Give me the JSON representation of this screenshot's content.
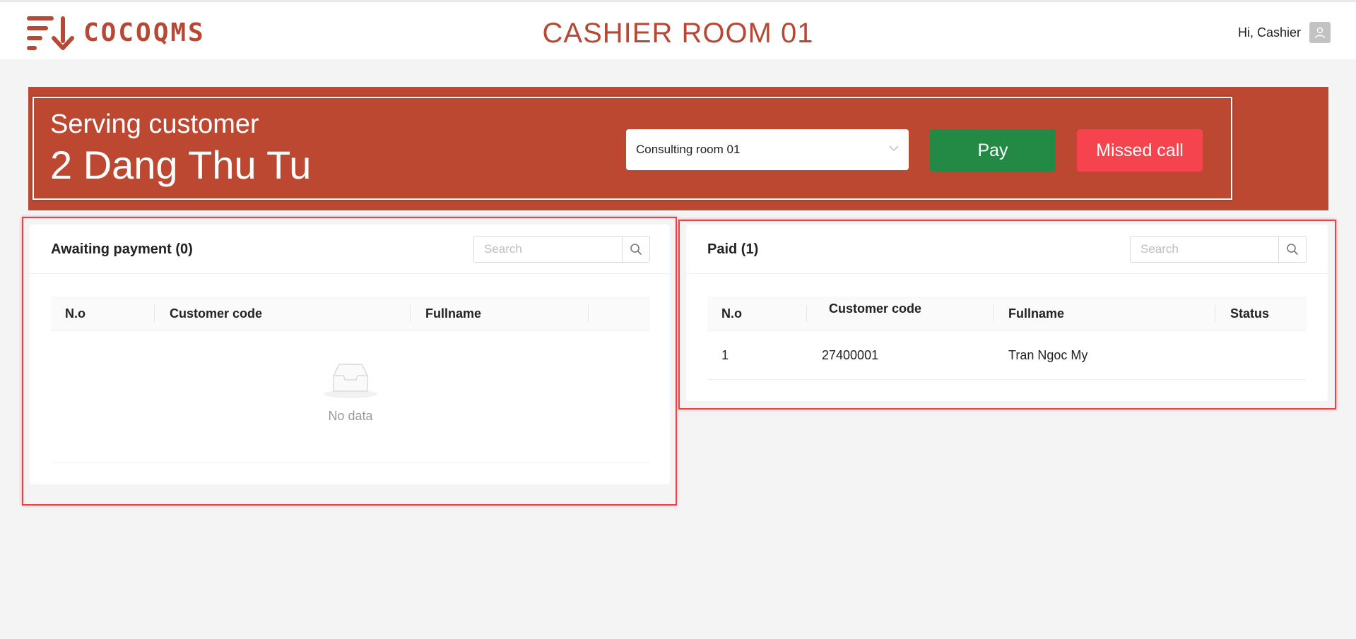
{
  "header": {
    "logo_text": "COCOQMS",
    "title": "CASHIER ROOM 01",
    "greeting": "Hi, Cashier"
  },
  "banner": {
    "serving_label": "Serving customer",
    "customer": "2 Dang Thu Tu",
    "room_select": {
      "value": "Consulting room 01"
    },
    "pay_label": "Pay",
    "missed_label": "Missed call"
  },
  "awaiting": {
    "title": "Awaiting payment (0)",
    "search_placeholder": "Search",
    "columns": [
      "N.o",
      "Customer code",
      "Fullname",
      ""
    ],
    "rows": [],
    "empty_text": "No data"
  },
  "paid": {
    "title": "Paid (1)",
    "search_placeholder": "Search",
    "columns": [
      "N.o",
      "Customer code",
      "Fullname",
      "Status"
    ],
    "rows": [
      {
        "no": "1",
        "code": "27400001",
        "fullname": "Tran Ngoc My",
        "status": ""
      }
    ]
  },
  "colors": {
    "brand": "#b84833",
    "banner_bg": "#bc4832",
    "pay": "#238a45",
    "missed": "#f5444e",
    "highlight": "#e8424a"
  }
}
